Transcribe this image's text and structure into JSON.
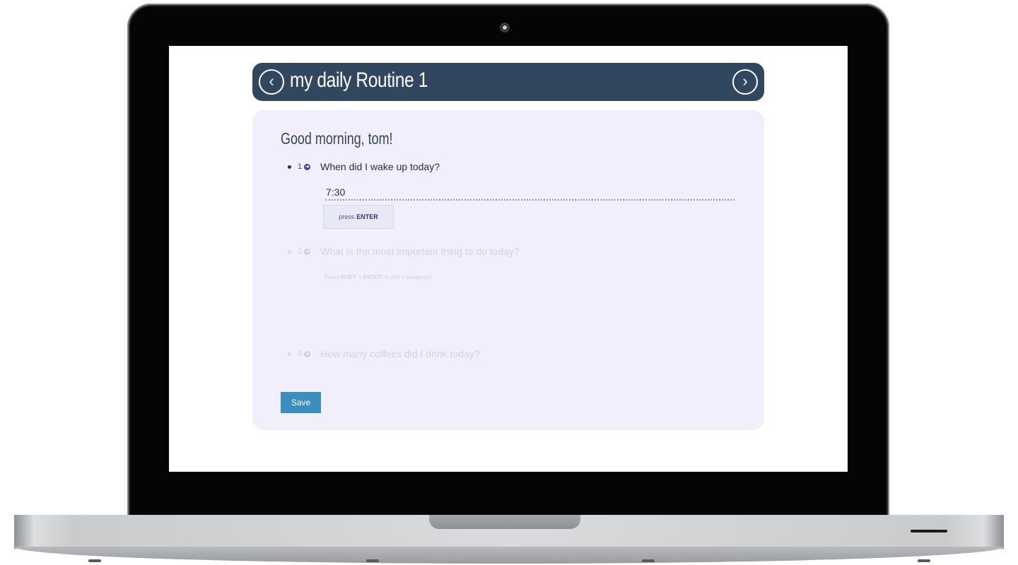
{
  "app": {
    "title": "my daily Routine 1",
    "nav_prev_glyph": "‹",
    "nav_next_glyph": "›"
  },
  "greeting": "Good morning, tom!",
  "questions": [
    {
      "number": "1",
      "text": "When did I wake up today?",
      "state": "active"
    },
    {
      "number": "2",
      "text": "What is the most important thing to do today?",
      "state": "pending"
    },
    {
      "number": "3",
      "text": "How many coffees did I drink today?",
      "state": "pending"
    }
  ],
  "answer_input": {
    "value": "7:30"
  },
  "enter_button": {
    "prefix": "press",
    "key": "ENTER"
  },
  "paragraph_hint": {
    "prefix": "Press",
    "keys": "SHIFT + ENTER",
    "suffix": "to add a paragraph"
  },
  "save_button": {
    "label": "Save"
  },
  "icons": {
    "nav_prev": "chevron-left-circle-icon",
    "nav_next": "chevron-right-circle-icon",
    "question_marker": "arrow-right-circle-icon"
  },
  "colors": {
    "header_bg": "#31475f",
    "card_bg": "#f0effb",
    "save_bg": "#3b8ec0",
    "active_text": "#243045",
    "inactive_text": "#cfd3ec"
  }
}
